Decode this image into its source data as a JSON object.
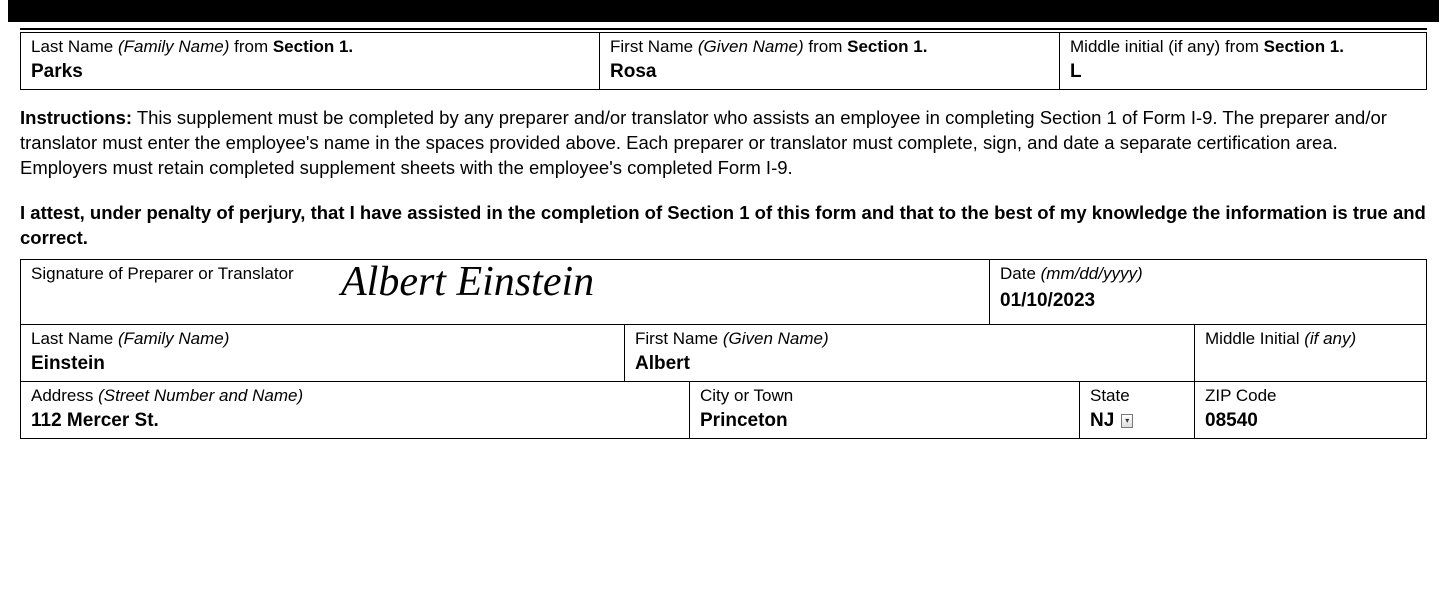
{
  "labels": {
    "lastNameFrom": {
      "pre": "Last Name ",
      "ital": "(Family Name)",
      "mid": " from ",
      "bold": "Section 1."
    },
    "firstNameFrom": {
      "pre": "First Name ",
      "ital": "(Given Name)",
      "mid": " from ",
      "bold": "Section 1."
    },
    "middleInitialFrom": {
      "pre": "Middle initial (if any) from ",
      "bold": "Section 1."
    },
    "signature": "Signature of Preparer or Translator",
    "date": {
      "pre": "Date ",
      "ital": "(mm/dd/yyyy)"
    },
    "lastName": {
      "pre": "Last Name ",
      "ital": "(Family Name)"
    },
    "firstName": {
      "pre": "First Name ",
      "ital": "(Given Name)"
    },
    "middleInitial": {
      "pre": "Middle Initial ",
      "ital": "(if any)"
    },
    "address": {
      "pre": "Address ",
      "ital": "(Street Number and Name)"
    },
    "city": "City or Town",
    "state": "State",
    "zip": "ZIP Code"
  },
  "employee": {
    "lastName": "Parks",
    "firstName": "Rosa",
    "middleInitial": "L"
  },
  "instructions": {
    "lead": "Instructions:",
    "body": "  This supplement must be completed by any preparer and/or translator who assists an employee in completing Section 1 of Form I-9. The preparer and/or translator must enter the employee's name in the spaces provided above.  Each preparer or translator must complete, sign, and date a separate certification area.  Employers must retain completed supplement sheets with the employee's completed Form I-9."
  },
  "attestation": "I attest, under penalty of perjury, that I have assisted in the completion of Section 1 of this form and that to the best of my knowledge the information is true and correct.",
  "preparer": {
    "signature": "Albert Einstein",
    "date": "01/10/2023",
    "lastName": "Einstein",
    "firstName": "Albert",
    "middleInitial": "",
    "address": "112 Mercer St.",
    "city": "Princeton",
    "state": "NJ",
    "zip": "08540"
  }
}
